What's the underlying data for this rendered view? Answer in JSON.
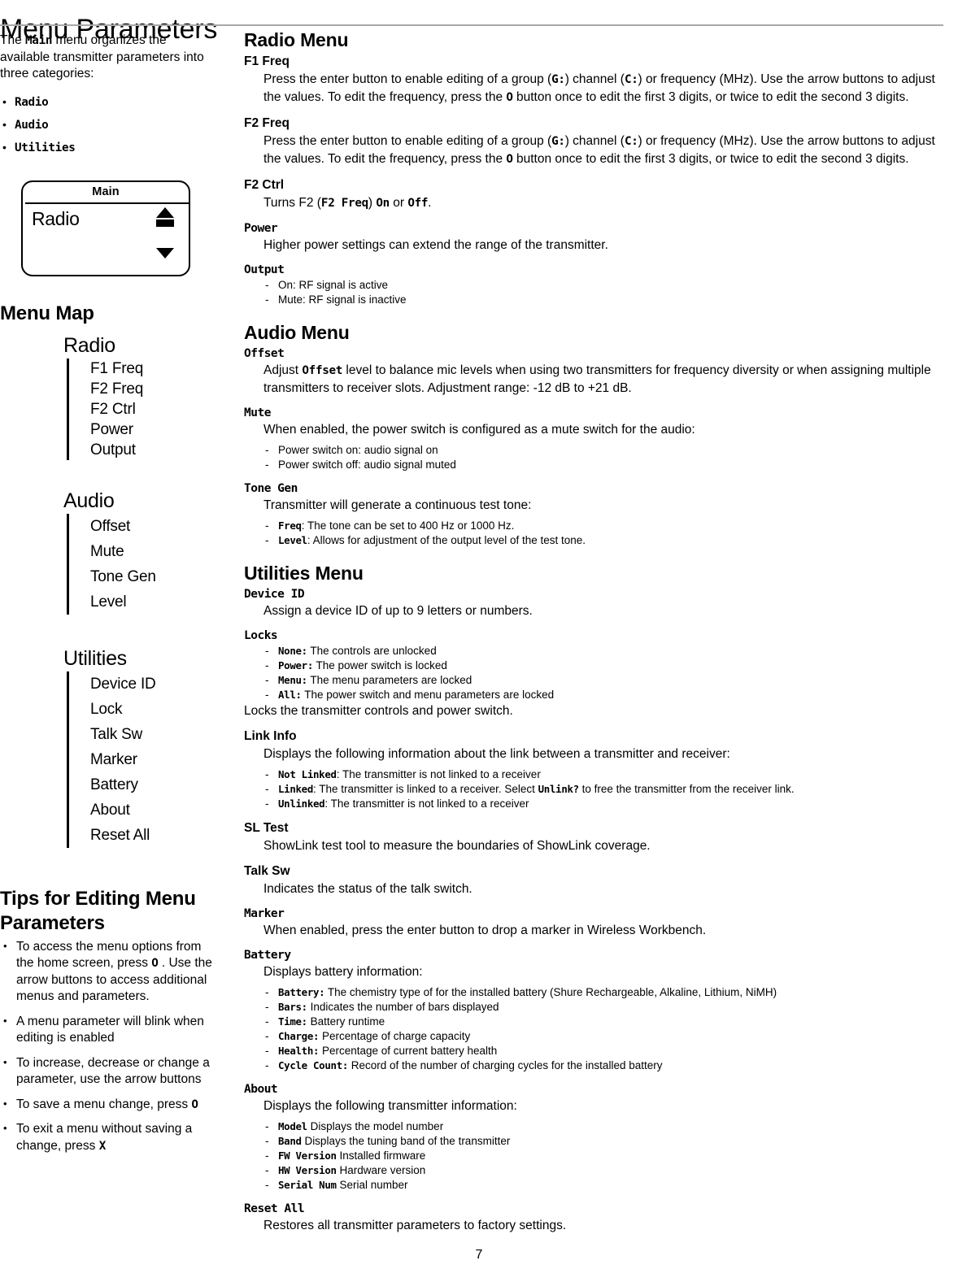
{
  "page": {
    "title": "Menu Parameters",
    "number": "7"
  },
  "left": {
    "intro": {
      "pre": "The ",
      "code": "Main",
      "post": " menu organizes the available transmitter parameters into three categories:"
    },
    "categories": [
      {
        "label": "Radio"
      },
      {
        "label": "Audio"
      },
      {
        "label": "Utilities"
      }
    ],
    "device": {
      "title": "Main",
      "item": "Radio",
      "up_icon": "triangle-up-icon",
      "bar_icon": "scroll-bar-icon",
      "down_icon": "triangle-down-icon"
    },
    "menu_map": {
      "heading": "Menu Map",
      "groups": [
        {
          "title": "Radio",
          "spacing": "tight",
          "items": [
            "F1 Freq",
            "F2 Freq",
            "F2 Ctrl",
            "Power",
            "Output"
          ]
        },
        {
          "title": "Audio",
          "spacing": "loose",
          "items": [
            "Offset",
            "Mute",
            "Tone Gen",
            "Level"
          ]
        },
        {
          "title": "Utilities",
          "spacing": "loose",
          "items": [
            "Device ID",
            "Lock",
            "Talk Sw",
            "Marker",
            "Battery",
            "About",
            "Reset All"
          ]
        }
      ]
    },
    "tips": {
      "heading": "Tips for Editing Menu Parameters",
      "items": [
        {
          "pre": "To access the menu options from the home screen, press ",
          "code": "O",
          "post": " . Use the arrow buttons to access additional menus and parameters."
        },
        {
          "pre": "A menu parameter will blink when editing is enabled",
          "code": "",
          "post": ""
        },
        {
          "pre": "To increase, decrease or change a parameter, use the arrow buttons",
          "code": "",
          "post": ""
        },
        {
          "pre": "To save a menu change, press ",
          "code": "O",
          "post": ""
        },
        {
          "pre": "To exit a menu without saving a change, press ",
          "code": "X",
          "post": ""
        }
      ]
    }
  },
  "right": {
    "radio_menu": {
      "heading": "Radio Menu",
      "f1_freq": {
        "title": "F1 Freq",
        "body_1": "Press the enter button to enable editing of a group (",
        "code_g": "G:",
        "body_2": ") channel (",
        "code_c": "C:",
        "body_3": ") or frequency (MHz). Use the arrow buttons to adjust the values. To edit the frequency, press the ",
        "code_o": "O",
        "body_4": " button once to edit the first 3 digits, or twice to edit the second 3 digits."
      },
      "f2_freq": {
        "title": "F2 Freq",
        "body_1": "Press the enter button to enable editing of a group (",
        "code_g": "G:",
        "body_2": ") channel (",
        "code_c": "C:",
        "body_3": ") or frequency (MHz). Use the arrow buttons to adjust the values. To edit the frequency, press the ",
        "code_o": "O",
        "body_4": " button once to edit the first 3 digits, or twice to edit the second 3 digits."
      },
      "f2_ctrl": {
        "title": "F2 Ctrl",
        "body_1": "Turns F2 (",
        "code_f2freq": "F2 Freq",
        "body_2": ") ",
        "code_on": "On",
        "body_3": " or ",
        "code_off": "Off",
        "body_4": "."
      },
      "power": {
        "title": "Power",
        "body": "Higher power settings can extend the range of the transmitter."
      },
      "output": {
        "title": "Output",
        "items": [
          "On: RF signal is active",
          "Mute: RF signal is inactive"
        ]
      }
    },
    "audio_menu": {
      "heading": "Audio Menu",
      "offset": {
        "title": "Offset",
        "body_1": "Adjust ",
        "code": "Offset",
        "body_2": " level to balance mic levels when using two transmitters for frequency diversity or when assigning multiple transmitters to receiver slots. Adjustment range: -12 dB to +21 dB."
      },
      "mute": {
        "title": "Mute",
        "body": "When enabled, the power switch is configured as a mute switch for the audio:",
        "items": [
          "Power switch on: audio signal on",
          "Power switch off: audio signal muted"
        ]
      },
      "tone_gen": {
        "title": "Tone Gen",
        "body": "Transmitter will generate a continuous test tone:",
        "items": [
          {
            "code": "Freq",
            "text": ": The tone can be set to 400 Hz or 1000 Hz."
          },
          {
            "code": "Level",
            "text": ": Allows for adjustment of the output level of the test tone."
          }
        ]
      }
    },
    "utilities_menu": {
      "heading": "Utilities Menu",
      "device_id": {
        "title": "Device ID",
        "body": "Assign a device ID of up to 9 letters or numbers."
      },
      "locks": {
        "title": "Locks",
        "items": [
          {
            "code": "None:",
            "text": " The controls are unlocked"
          },
          {
            "code": "Power:",
            "text": " The power switch is locked"
          },
          {
            "code": "Menu:",
            "text": " The menu parameters are locked"
          },
          {
            "code": "All:",
            "text": " The power switch and menu parameters are locked"
          }
        ],
        "footer": "Locks the transmitter controls and power switch."
      },
      "link_info": {
        "title": "Link Info",
        "body": "Displays the following information about the link between a transmitter and receiver:",
        "items": [
          {
            "code": "Not Linked",
            "text": ": The transmitter is not linked to a receiver",
            "code2": "",
            "text2": ""
          },
          {
            "code": "Linked",
            "text": ": The transmitter is linked to a receiver. Select ",
            "code2": "Unlink?",
            "text2": " to free the transmitter from the receiver link."
          },
          {
            "code": "Unlinked",
            "text": ": The transmitter is not linked to a receiver",
            "code2": "",
            "text2": ""
          }
        ]
      },
      "sl_test": {
        "title": "SL Test",
        "body": "ShowLink test tool to measure the boundaries of ShowLink coverage."
      },
      "talk_sw": {
        "title": "Talk Sw",
        "body": "Indicates the status of the talk switch."
      },
      "marker": {
        "title": "Marker",
        "body": "When enabled, press the enter button to drop a marker in Wireless Workbench."
      },
      "battery": {
        "title": "Battery",
        "body": "Displays battery information:",
        "items": [
          {
            "code": "Battery:",
            "text": " The chemistry type of for the installed battery (Shure Rechargeable, Alkaline, Lithium, NiMH)"
          },
          {
            "code": "Bars:",
            "text": " Indicates the number of bars displayed"
          },
          {
            "code": "Time:",
            "text": " Battery runtime"
          },
          {
            "code": "Charge:",
            "text": " Percentage of charge capacity"
          },
          {
            "code": "Health:",
            "text": " Percentage of current battery health"
          },
          {
            "code": "Cycle Count:",
            "text": " Record of the number of charging cycles for the installed battery"
          }
        ]
      },
      "about": {
        "title": "About",
        "body": "Displays the following transmitter information:",
        "items": [
          {
            "code": "Model",
            "text": " Displays the model number"
          },
          {
            "code": "Band",
            "text": " Displays the tuning band of the transmitter"
          },
          {
            "code": "FW Version",
            "text": " Installed firmware"
          },
          {
            "code": "HW Version",
            "text": " Hardware version"
          },
          {
            "code": "Serial Num",
            "text": " Serial number"
          }
        ]
      },
      "reset_all": {
        "title": "Reset All",
        "body": "Restores all transmitter parameters to factory settings."
      }
    }
  }
}
